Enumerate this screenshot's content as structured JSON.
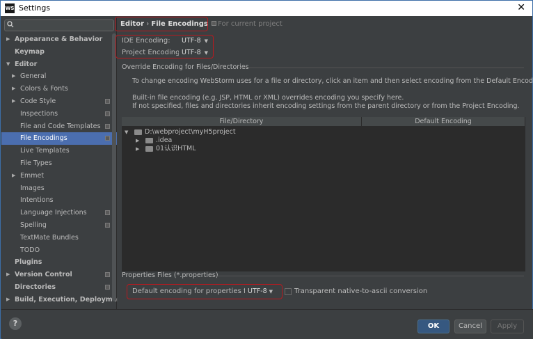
{
  "window": {
    "title": "Settings",
    "app_icon": "WS",
    "close_glyph": "✕"
  },
  "search": {
    "placeholder": "",
    "icon": "search-icon"
  },
  "sidebar": {
    "items": [
      {
        "label": "Appearance & Behavior",
        "indent": 0,
        "bold": true,
        "arrow": "▶",
        "project": false,
        "selected": false
      },
      {
        "label": "Keymap",
        "indent": 0,
        "bold": true,
        "arrow": "",
        "project": false,
        "selected": false
      },
      {
        "label": "Editor",
        "indent": 0,
        "bold": true,
        "arrow": "▼",
        "project": false,
        "selected": false
      },
      {
        "label": "General",
        "indent": 1,
        "bold": false,
        "arrow": "▶",
        "project": false,
        "selected": false
      },
      {
        "label": "Colors & Fonts",
        "indent": 1,
        "bold": false,
        "arrow": "▶",
        "project": false,
        "selected": false
      },
      {
        "label": "Code Style",
        "indent": 1,
        "bold": false,
        "arrow": "▶",
        "project": true,
        "selected": false
      },
      {
        "label": "Inspections",
        "indent": 1,
        "bold": false,
        "arrow": "",
        "project": true,
        "selected": false
      },
      {
        "label": "File and Code Templates",
        "indent": 1,
        "bold": false,
        "arrow": "",
        "project": true,
        "selected": false
      },
      {
        "label": "File Encodings",
        "indent": 1,
        "bold": false,
        "arrow": "",
        "project": true,
        "selected": true
      },
      {
        "label": "Live Templates",
        "indent": 1,
        "bold": false,
        "arrow": "",
        "project": false,
        "selected": false
      },
      {
        "label": "File Types",
        "indent": 1,
        "bold": false,
        "arrow": "",
        "project": false,
        "selected": false
      },
      {
        "label": "Emmet",
        "indent": 1,
        "bold": false,
        "arrow": "▶",
        "project": false,
        "selected": false
      },
      {
        "label": "Images",
        "indent": 1,
        "bold": false,
        "arrow": "",
        "project": false,
        "selected": false
      },
      {
        "label": "Intentions",
        "indent": 1,
        "bold": false,
        "arrow": "",
        "project": false,
        "selected": false
      },
      {
        "label": "Language Injections",
        "indent": 1,
        "bold": false,
        "arrow": "",
        "project": true,
        "selected": false
      },
      {
        "label": "Spelling",
        "indent": 1,
        "bold": false,
        "arrow": "",
        "project": true,
        "selected": false
      },
      {
        "label": "TextMate Bundles",
        "indent": 1,
        "bold": false,
        "arrow": "",
        "project": false,
        "selected": false
      },
      {
        "label": "TODO",
        "indent": 1,
        "bold": false,
        "arrow": "",
        "project": false,
        "selected": false
      },
      {
        "label": "Plugins",
        "indent": 0,
        "bold": true,
        "arrow": "",
        "project": false,
        "selected": false
      },
      {
        "label": "Version Control",
        "indent": 0,
        "bold": true,
        "arrow": "▶",
        "project": true,
        "selected": false
      },
      {
        "label": "Directories",
        "indent": 0,
        "bold": true,
        "arrow": "",
        "project": true,
        "selected": false
      },
      {
        "label": "Build, Execution, Deployment",
        "indent": 0,
        "bold": true,
        "arrow": "▶",
        "project": false,
        "selected": false
      }
    ]
  },
  "breadcrumb": {
    "parent": "Editor",
    "separator": "›",
    "current": "File Encodings",
    "scope": "For current project"
  },
  "encodings": {
    "ide_label": "IDE Encoding:",
    "ide_value": "UTF-8",
    "project_label": "Project Encoding:",
    "project_value": "UTF-8"
  },
  "override": {
    "title": "Override Encoding for Files/Directories",
    "line1": "To change encoding WebStorm uses for a file or directory, click an item and then select encoding from the Default Encoding list.",
    "line2": "Built-in file encoding (e.g. JSP, HTML or XML) overrides encoding you specify here.",
    "line3": "If not specified, files and directories inherit encoding settings from the parent directory or from the Project Encoding."
  },
  "table": {
    "headers": [
      "File/Directory",
      "Default Encoding"
    ],
    "rows": [
      {
        "label": "D:\\webproject\\myH5project",
        "depth": 0,
        "arrow": "▼"
      },
      {
        "label": ".idea",
        "depth": 1,
        "arrow": "▶"
      },
      {
        "label": "01认识HTML",
        "depth": 1,
        "arrow": "▶"
      }
    ]
  },
  "properties": {
    "title": "Properties Files (*.properties)",
    "default_label": "Default encoding for properties files:",
    "default_value": "UTF-8",
    "transparent_label": "Transparent native-to-ascii conversion",
    "transparent_checked": false
  },
  "buttons": {
    "help": "?",
    "ok": "OK",
    "cancel": "Cancel",
    "apply": "Apply"
  },
  "colors": {
    "background": "#3c3f41",
    "selection": "#4b6eaf",
    "highlight_box": "#b9191f",
    "ok_button": "#365880"
  }
}
